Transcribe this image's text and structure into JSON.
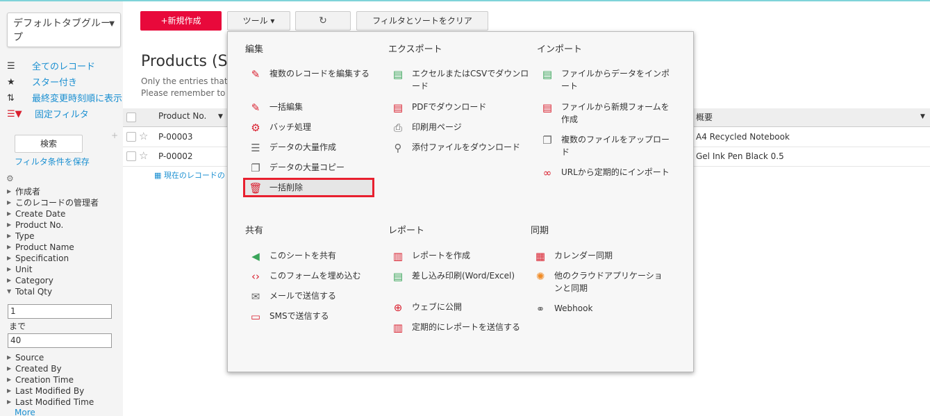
{
  "sidebar": {
    "tabgroup": "デフォルトタブグループ",
    "views": [
      "全てのレコード",
      "スター付き",
      "最終変更時刻順に表示",
      "固定フィルタ"
    ],
    "search_button": "検索",
    "save_filter": "フィルタ条件を保存",
    "fields": [
      "作成者",
      "このレコードの管理者",
      "Create Date",
      "Product No.",
      "Type",
      "Product Name",
      "Specification",
      "Unit",
      "Category",
      "Total Qty"
    ],
    "qty_from": "1",
    "until_label": "まで",
    "qty_to": "40",
    "fields2": [
      "Source",
      "Created By",
      "Creation Time",
      "Last Modified By",
      "Last Modified Time"
    ],
    "more": "More"
  },
  "toolbar": {
    "new_label": "+新規作成",
    "tools_label": "ツール ▾",
    "refresh_icon": "↻",
    "clear_label": "フィルタとソートをクリア"
  },
  "main": {
    "title": "Products (S",
    "note1": "Only the entries that",
    "note2": "Please remember to",
    "col_product": "Product No.",
    "col_summary": "概要",
    "rows": [
      {
        "no": "P-00003",
        "summary": "A4 Recycled Notebook"
      },
      {
        "no": "P-00002",
        "summary": "Gel Ink Pen Black 0.5"
      }
    ],
    "summary_link": "現在のレコードの"
  },
  "menu": {
    "edit": {
      "title": "編集",
      "items": [
        "複数のレコードを編集する",
        "一括編集",
        "バッチ処理",
        "データの大量作成",
        "データの大量コピー",
        "一括削除"
      ]
    },
    "export": {
      "title": "エクスポート",
      "items": [
        "エクセルまたはCSVでダウンロード",
        "PDFでダウンロード",
        "印刷用ページ",
        "添付ファイルをダウンロード"
      ]
    },
    "import": {
      "title": "インポート",
      "items": [
        "ファイルからデータをインポート",
        "ファイルから新規フォームを作成",
        "複数のファイルをアップロード",
        "URLから定期的にインポート"
      ]
    },
    "share": {
      "title": "共有",
      "items": [
        "このシートを共有",
        "このフォームを埋め込む",
        "メールで送信する",
        "SMSで送信する"
      ]
    },
    "report": {
      "title": "レポート",
      "items": [
        "レポートを作成",
        "差し込み印刷(Word/Excel)",
        "ウェブに公開",
        "定期的にレポートを送信する"
      ]
    },
    "sync": {
      "title": "同期",
      "items": [
        "カレンダー同期",
        "他のクラウドアプリケーションと同期",
        "Webhook"
      ]
    }
  }
}
